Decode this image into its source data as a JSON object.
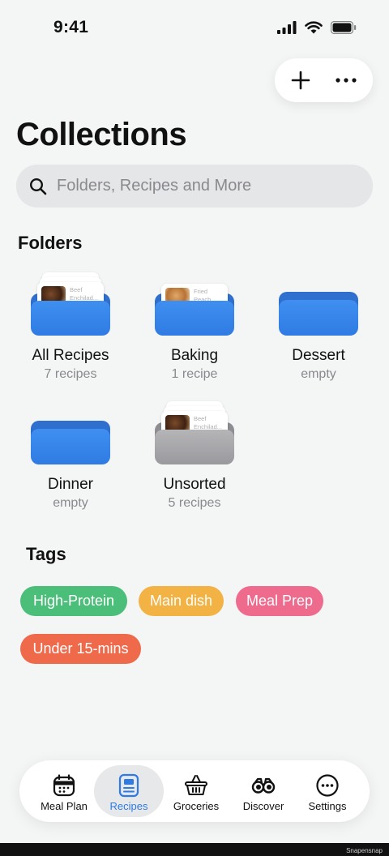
{
  "status": {
    "time": "9:41"
  },
  "header": {
    "title": "Collections",
    "add_icon": "plus-icon",
    "more_icon": "ellipsis-icon"
  },
  "search": {
    "placeholder": "Folders, Recipes and More"
  },
  "folders_section": {
    "title": "Folders",
    "items": [
      {
        "name": "All Recipes",
        "count": "7 recipes",
        "preview": "Beef Enchilad...",
        "color": "blue"
      },
      {
        "name": "Baking",
        "count": "1 recipe",
        "preview": "Fried Peach Co...",
        "color": "blue"
      },
      {
        "name": "Dessert",
        "count": "empty",
        "color": "blue"
      },
      {
        "name": "Dinner",
        "count": "empty",
        "color": "blue"
      },
      {
        "name": "Unsorted",
        "count": "5 recipes",
        "preview": "Beef Enchilad...",
        "color": "gray"
      }
    ]
  },
  "tags_section": {
    "title": "Tags",
    "items": [
      {
        "label": "High-Protein",
        "color": "#4bbf7a"
      },
      {
        "label": "Main dish",
        "color": "#f2b244"
      },
      {
        "label": "Meal Prep",
        "color": "#ee6b8e"
      },
      {
        "label": "Under 15-mins",
        "color": "#ef6a4b"
      }
    ]
  },
  "tab_bar": {
    "active": "Recipes",
    "tabs": [
      {
        "label": "Meal Plan",
        "icon": "calendar-icon"
      },
      {
        "label": "Recipes",
        "icon": "recipe-book-icon"
      },
      {
        "label": "Groceries",
        "icon": "basket-icon"
      },
      {
        "label": "Discover",
        "icon": "binoculars-icon"
      },
      {
        "label": "Settings",
        "icon": "ellipsis-circle-icon"
      }
    ]
  },
  "watermark": "Snapensnap"
}
